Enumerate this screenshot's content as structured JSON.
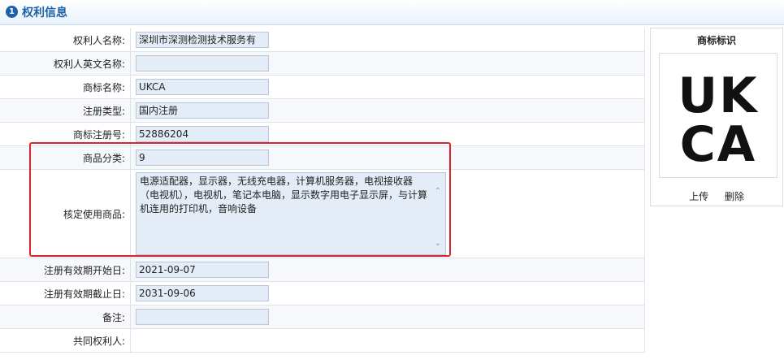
{
  "header": {
    "number": "1",
    "title": "权利信息"
  },
  "form": {
    "rows": [
      {
        "label": "权利人名称:",
        "value": "深圳市深测检测技术服务有"
      },
      {
        "label": "权利人英文名称:",
        "value": ""
      },
      {
        "label": "商标名称:",
        "value": "UKCA"
      },
      {
        "label": "注册类型:",
        "value": "国内注册"
      },
      {
        "label": "商标注册号:",
        "value": "52886204"
      },
      {
        "label": "商品分类:",
        "value": "9"
      },
      {
        "label": "核定使用商品:",
        "value": "电源适配器，显示器，无线充电器，计算机服务器，电视接收器（电视机），电视机，笔记本电脑，显示数字用电子显示屏，与计算机连用的打印机，音响设备"
      },
      {
        "label": "注册有效期开始日:",
        "value": "2021-09-07"
      },
      {
        "label": "注册有效期截止日:",
        "value": "2031-09-06"
      },
      {
        "label": "备注:",
        "value": ""
      },
      {
        "label": "共同权利人:",
        "value": ""
      }
    ]
  },
  "logo_panel": {
    "title": "商标标识",
    "logo_line1": "UK",
    "logo_line2": "CA",
    "upload_label": "上传",
    "delete_label": "删除"
  },
  "colors": {
    "accent": "#1f5fa8",
    "highlight": "#d9262e",
    "field_bg": "#e4edf7"
  },
  "icons": {
    "section_number": "circled-number-1",
    "scroll_up": "chevron-up-icon",
    "scroll_down": "chevron-down-icon"
  }
}
